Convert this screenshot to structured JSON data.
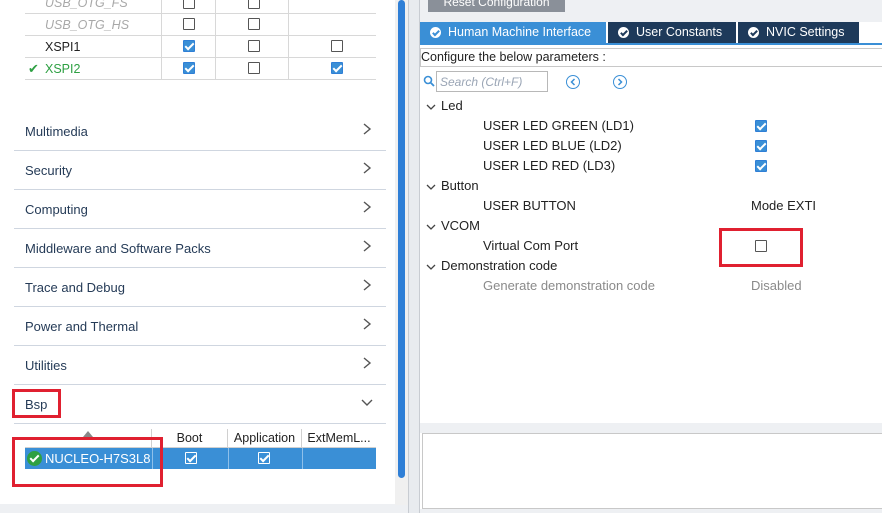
{
  "peripherals": [
    {
      "name": "USB_OTG_FS",
      "state": "grey",
      "c1": false,
      "c2": false,
      "c3": null
    },
    {
      "name": "USB_OTG_HS",
      "state": "grey",
      "c1": false,
      "c2": false,
      "c3": null
    },
    {
      "name": "XSPI1",
      "state": "normal",
      "c1": true,
      "c2": false,
      "c3": false
    },
    {
      "name": "XSPI2",
      "state": "green",
      "c1": true,
      "c2": false,
      "c3": true
    }
  ],
  "categories": [
    "Multimedia",
    "Security",
    "Computing",
    "Middleware and Software Packs",
    "Trace and Debug",
    "Power and Thermal",
    "Utilities",
    "Bsp"
  ],
  "bsp": {
    "headers": [
      "Boot",
      "Application",
      "ExtMemL..."
    ],
    "row": {
      "name": "NUCLEO-H7S3L8",
      "boot": true,
      "application": true
    }
  },
  "right": {
    "reset_button": "Reset Configuration",
    "tabs": [
      "Human Machine Interface",
      "User Constants",
      "NVIC Settings"
    ],
    "configure_label": "Configure the below parameters :",
    "search_placeholder": "Search (Ctrl+F)",
    "groups": {
      "led": {
        "label": "Led",
        "items": [
          {
            "label": "USER LED GREEN  (LD1)",
            "checked": true
          },
          {
            "label": "USER LED BLUE (LD2)",
            "checked": true
          },
          {
            "label": "USER LED RED (LD3)",
            "checked": true
          }
        ]
      },
      "button": {
        "label": "Button",
        "item": {
          "label": "USER BUTTON",
          "value": "Mode EXTI"
        }
      },
      "vcom": {
        "label": "VCOM",
        "item": {
          "label": "Virtual Com Port",
          "checked": false
        }
      },
      "demo": {
        "label": "Demonstration code",
        "item": {
          "label": "Generate demonstration code",
          "value": "Disabled"
        }
      }
    }
  },
  "colors": {
    "accent": "#3a8fd6",
    "tab_dark": "#1e3a5a",
    "highlight_red": "#e02030",
    "ok_green": "#2ea043"
  }
}
